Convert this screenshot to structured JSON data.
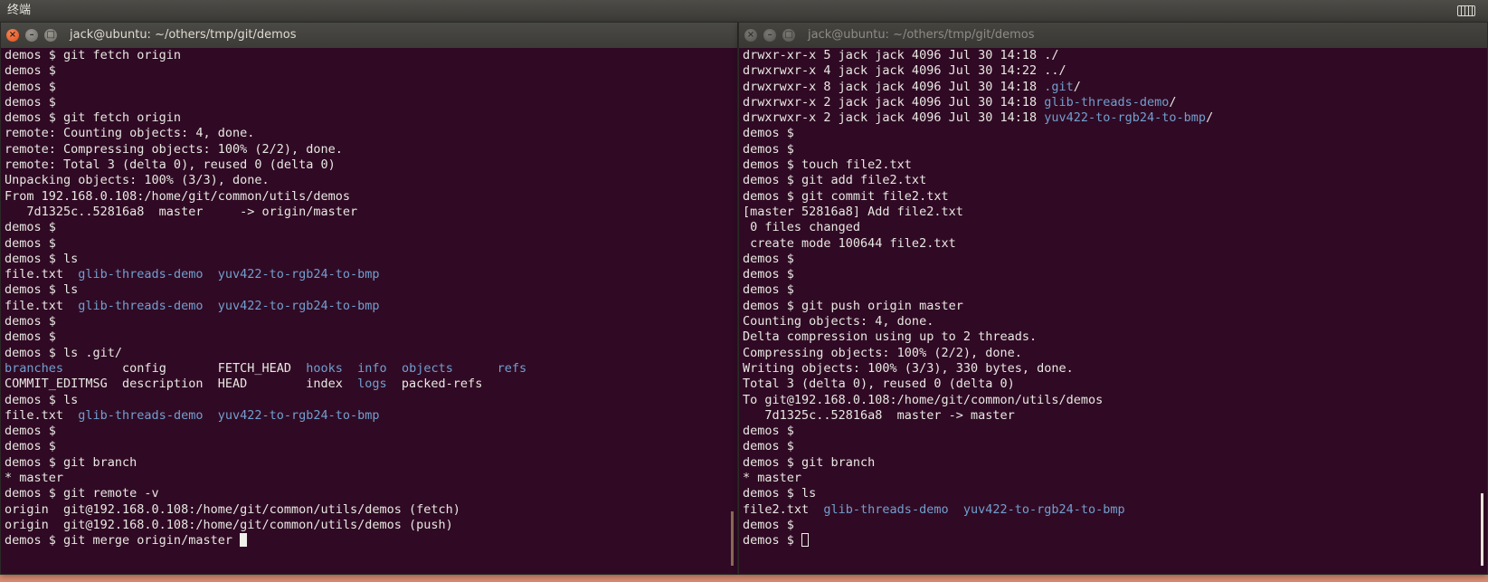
{
  "topbar": {
    "title": "终端",
    "keyboard_icon": "keyboard-icon"
  },
  "left_window": {
    "title": "jack@ubuntu: ~/others/tmp/git/demos",
    "buttons": {
      "close": "×",
      "minimize": "–",
      "maximize": "□"
    },
    "lines": [
      [
        {
          "t": "demos $ git fetch origin"
        }
      ],
      [
        {
          "t": "demos $"
        }
      ],
      [
        {
          "t": "demos $"
        }
      ],
      [
        {
          "t": "demos $"
        }
      ],
      [
        {
          "t": "demos $ git fetch origin"
        }
      ],
      [
        {
          "t": "remote: Counting objects: 4, done."
        }
      ],
      [
        {
          "t": "remote: Compressing objects: 100% (2/2), done."
        }
      ],
      [
        {
          "t": "remote: Total 3 (delta 0), reused 0 (delta 0)"
        }
      ],
      [
        {
          "t": "Unpacking objects: 100% (3/3), done."
        }
      ],
      [
        {
          "t": "From 192.168.0.108:/home/git/common/utils/demos"
        }
      ],
      [
        {
          "t": "   7d1325c..52816a8  master     -> origin/master"
        }
      ],
      [
        {
          "t": "demos $"
        }
      ],
      [
        {
          "t": "demos $"
        }
      ],
      [
        {
          "t": "demos $ ls"
        }
      ],
      [
        {
          "t": "file.txt  "
        },
        {
          "t": "glib-threads-demo",
          "c": "dir"
        },
        {
          "t": "  "
        },
        {
          "t": "yuv422-to-rgb24-to-bmp",
          "c": "dir"
        }
      ],
      [
        {
          "t": "demos $ ls"
        }
      ],
      [
        {
          "t": "file.txt  "
        },
        {
          "t": "glib-threads-demo",
          "c": "dir"
        },
        {
          "t": "  "
        },
        {
          "t": "yuv422-to-rgb24-to-bmp",
          "c": "dir"
        }
      ],
      [
        {
          "t": "demos $"
        }
      ],
      [
        {
          "t": "demos $"
        }
      ],
      [
        {
          "t": "demos $ ls .git/"
        }
      ],
      [
        {
          "t": "branches",
          "c": "dir"
        },
        {
          "t": "        config       FETCH_HEAD  "
        },
        {
          "t": "hooks",
          "c": "dir"
        },
        {
          "t": "  "
        },
        {
          "t": "info",
          "c": "dir"
        },
        {
          "t": "  "
        },
        {
          "t": "objects",
          "c": "dir"
        },
        {
          "t": "      "
        },
        {
          "t": "refs",
          "c": "dir"
        }
      ],
      [
        {
          "t": "COMMIT_EDITMSG  description  HEAD        index  "
        },
        {
          "t": "logs",
          "c": "dir"
        },
        {
          "t": "  packed-refs"
        }
      ],
      [
        {
          "t": "demos $ ls"
        }
      ],
      [
        {
          "t": "file.txt  "
        },
        {
          "t": "glib-threads-demo",
          "c": "dir"
        },
        {
          "t": "  "
        },
        {
          "t": "yuv422-to-rgb24-to-bmp",
          "c": "dir"
        }
      ],
      [
        {
          "t": "demos $"
        }
      ],
      [
        {
          "t": "demos $"
        }
      ],
      [
        {
          "t": "demos $ git branch"
        }
      ],
      [
        {
          "t": "* master"
        }
      ],
      [
        {
          "t": "demos $ git remote -v"
        }
      ],
      [
        {
          "t": "origin  git@192.168.0.108:/home/git/common/utils/demos (fetch)"
        }
      ],
      [
        {
          "t": "origin  git@192.168.0.108:/home/git/common/utils/demos (push)"
        }
      ],
      [
        {
          "t": "demos $ git merge origin/master "
        },
        {
          "cursor": "solid"
        }
      ]
    ]
  },
  "right_window": {
    "title": "jack@ubuntu: ~/others/tmp/git/demos",
    "buttons": {
      "close": "×",
      "minimize": "–",
      "maximize": "□"
    },
    "lines": [
      [
        {
          "t": "drwxr-xr-x 5 jack jack 4096 Jul 30 14:18 ./"
        }
      ],
      [
        {
          "t": "drwxrwxr-x 4 jack jack 4096 Jul 30 14:22 ../"
        }
      ],
      [
        {
          "t": "drwxrwxr-x 8 jack jack 4096 Jul 30 14:18 "
        },
        {
          "t": ".git",
          "c": "dir"
        },
        {
          "t": "/"
        }
      ],
      [
        {
          "t": "drwxrwxr-x 2 jack jack 4096 Jul 30 14:18 "
        },
        {
          "t": "glib-threads-demo",
          "c": "dir"
        },
        {
          "t": "/"
        }
      ],
      [
        {
          "t": "drwxrwxr-x 2 jack jack 4096 Jul 30 14:18 "
        },
        {
          "t": "yuv422-to-rgb24-to-bmp",
          "c": "dir"
        },
        {
          "t": "/"
        }
      ],
      [
        {
          "t": "demos $"
        }
      ],
      [
        {
          "t": "demos $"
        }
      ],
      [
        {
          "t": "demos $ touch file2.txt"
        }
      ],
      [
        {
          "t": "demos $ git add file2.txt"
        }
      ],
      [
        {
          "t": "demos $ git commit file2.txt"
        }
      ],
      [
        {
          "t": "[master 52816a8] Add file2.txt"
        }
      ],
      [
        {
          "t": " 0 files changed"
        }
      ],
      [
        {
          "t": " create mode 100644 file2.txt"
        }
      ],
      [
        {
          "t": "demos $"
        }
      ],
      [
        {
          "t": "demos $"
        }
      ],
      [
        {
          "t": "demos $"
        }
      ],
      [
        {
          "t": "demos $ git push origin master"
        }
      ],
      [
        {
          "t": "Counting objects: 4, done."
        }
      ],
      [
        {
          "t": "Delta compression using up to 2 threads."
        }
      ],
      [
        {
          "t": "Compressing objects: 100% (2/2), done."
        }
      ],
      [
        {
          "t": "Writing objects: 100% (3/3), 330 bytes, done."
        }
      ],
      [
        {
          "t": "Total 3 (delta 0), reused 0 (delta 0)"
        }
      ],
      [
        {
          "t": "To git@192.168.0.108:/home/git/common/utils/demos"
        }
      ],
      [
        {
          "t": "   7d1325c..52816a8  master -> master"
        }
      ],
      [
        {
          "t": "demos $"
        }
      ],
      [
        {
          "t": "demos $"
        }
      ],
      [
        {
          "t": "demos $ git branch"
        }
      ],
      [
        {
          "t": "* master"
        }
      ],
      [
        {
          "t": "demos $ ls"
        }
      ],
      [
        {
          "t": "file2.txt  "
        },
        {
          "t": "glib-threads-demo",
          "c": "dir"
        },
        {
          "t": "  "
        },
        {
          "t": "yuv422-to-rgb24-to-bmp",
          "c": "dir"
        }
      ],
      [
        {
          "t": "demos $"
        }
      ],
      [
        {
          "t": "demos $ "
        },
        {
          "cursor": "hollow"
        }
      ]
    ]
  },
  "colors": {
    "terminal_bg": "#300a24",
    "terminal_fg": "#e8e8e2",
    "directory": "#729fcf",
    "close_button": "#df4b16"
  }
}
